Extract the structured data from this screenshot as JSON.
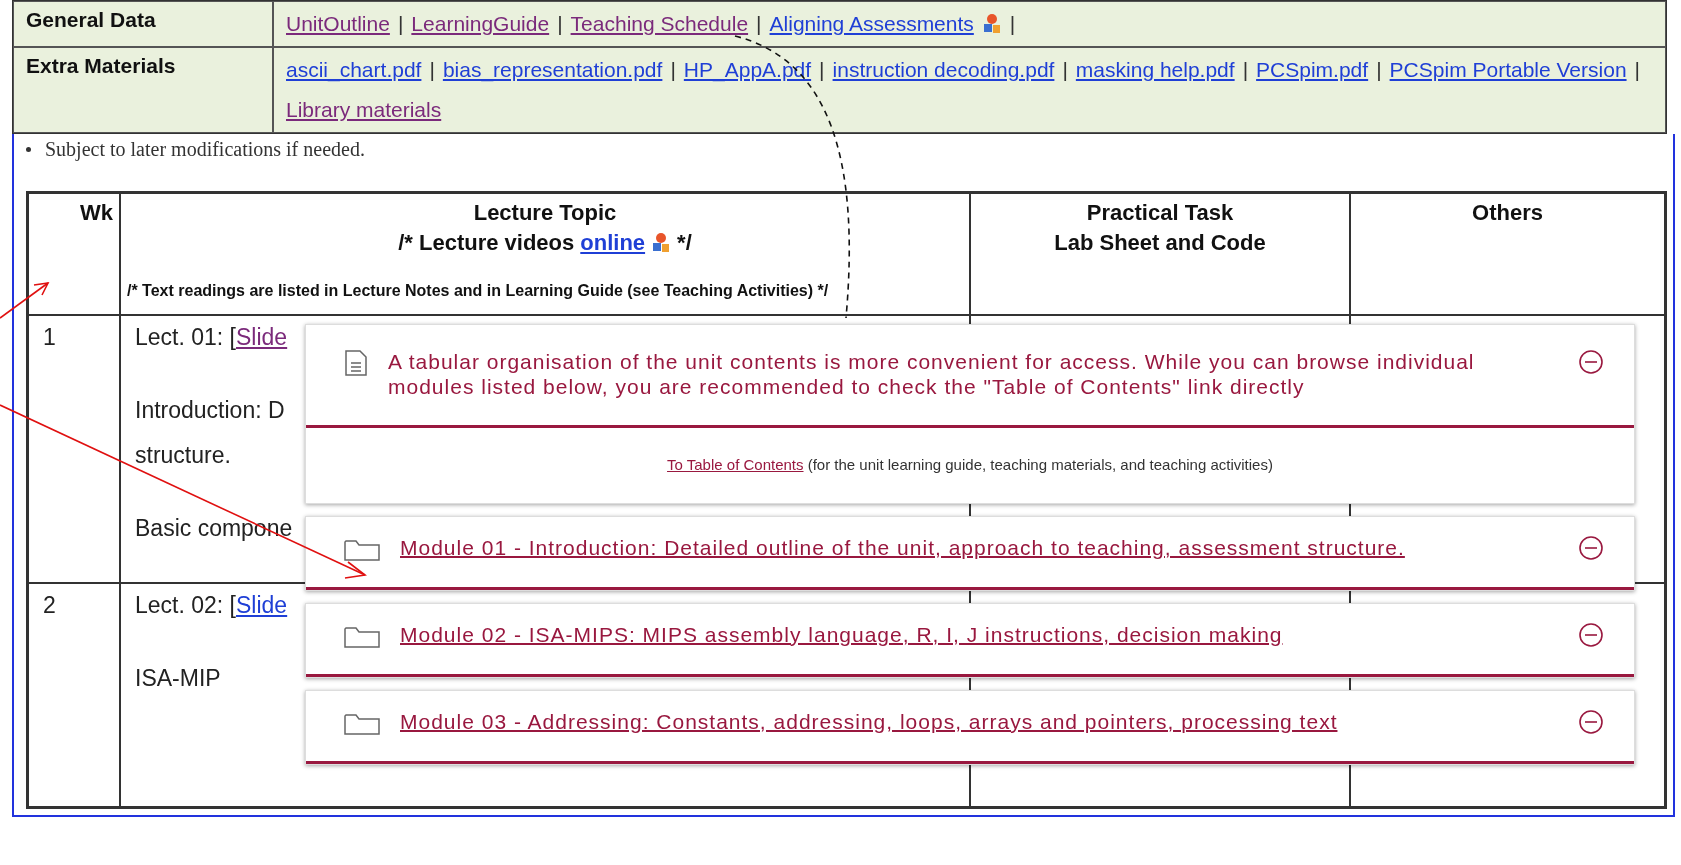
{
  "general_table": {
    "separator": "|",
    "rows": [
      {
        "label": "General Data",
        "links": [
          {
            "text": "UnitOutline",
            "visited": true,
            "icon": false
          },
          {
            "text": "LearningGuide",
            "visited": true,
            "icon": false
          },
          {
            "text": "Teaching Schedule",
            "visited": true,
            "icon": false
          },
          {
            "text": "Aligning Assessments",
            "visited": false,
            "icon": true
          }
        ]
      },
      {
        "label": "Extra Materials",
        "links": [
          {
            "text": "ascii_chart.pdf",
            "visited": false,
            "icon": false
          },
          {
            "text": "bias_representation.pdf",
            "visited": false,
            "icon": false
          },
          {
            "text": "HP_AppA.pdf",
            "visited": false,
            "icon": false
          },
          {
            "text": "instruction decoding.pdf",
            "visited": false,
            "icon": false
          },
          {
            "text": "masking help.pdf",
            "visited": false,
            "icon": false
          },
          {
            "text": "PCSpim.pdf",
            "visited": false,
            "icon": false
          },
          {
            "text": "PCSpim Portable Version",
            "visited": false,
            "icon": false
          },
          {
            "text": "Library materials",
            "visited": true,
            "icon": false
          }
        ]
      }
    ]
  },
  "note": "Subject to later modifications if needed.",
  "schedule": {
    "headers": {
      "wk": "Wk",
      "lecture_title": "Lecture Topic",
      "videos_prefix": "/* Lecture videos",
      "videos_link": "online",
      "videos_suffix": "*/",
      "readings": "/* Text readings are listed in Lecture Notes and in Learning Guide (see Teaching Activities) */",
      "practical_title": "Practical Task",
      "practical_sub": "Lab Sheet and Code",
      "others": "Others"
    },
    "rows": [
      {
        "wk": "1",
        "prefix": "Lect. 01: [",
        "link": "Slide",
        "visited": true,
        "paragraphs": [
          [
            "Introduction: D",
            "structure."
          ],
          [
            "Basic compone"
          ]
        ]
      },
      {
        "wk": "2",
        "prefix": "Lect. 02: [",
        "link": "Slide",
        "visited": false,
        "paragraphs": [
          [
            "ISA-MIP"
          ]
        ]
      }
    ]
  },
  "overlay": {
    "intro": {
      "text": "A tabular organisation of the unit contents is more convenient for access. While you can browse individual modules listed below, you are recommended to check the \"Table of Contents\" link directly",
      "link": "To Table of Contents",
      "link_note": "(for the unit learning guide, teaching materials, and teaching activities)",
      "expanded": true
    },
    "modules": [
      {
        "title": "Module 01 - Introduction: Detailed outline of the unit, approach to teaching, assessment structure.",
        "expanded": true
      },
      {
        "title": "Module 02 - ISA-MIPS: MIPS assembly language, R, I, J instructions, decision making",
        "expanded": true
      },
      {
        "title": "Module 03 - Addressing: Constants, addressing, loops, arrays and pointers, processing text",
        "expanded": true
      }
    ]
  }
}
